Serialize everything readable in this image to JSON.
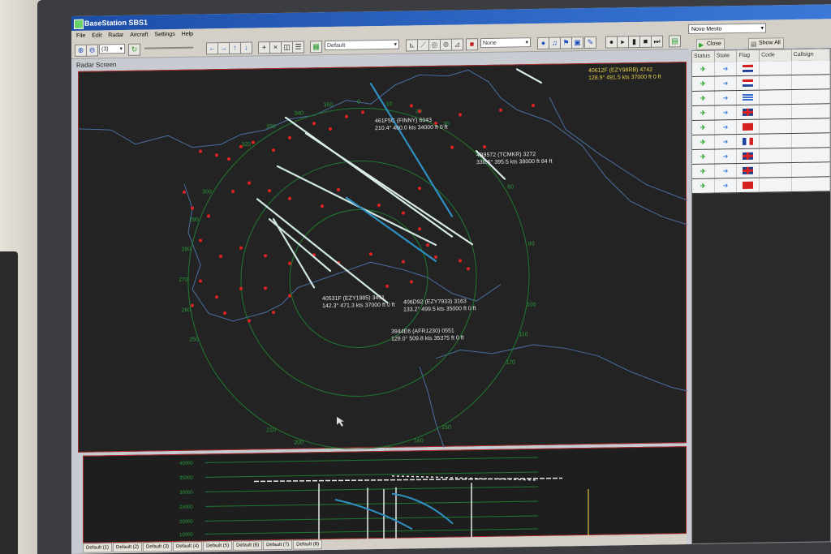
{
  "window": {
    "title": "BaseStation SBS1"
  },
  "menu": [
    "File",
    "Edit",
    "Radar",
    "Aircraft",
    "Settings",
    "Help"
  ],
  "toolbar": {
    "zoom_value": "(3)",
    "profile_select": "Default",
    "filter_select": "None",
    "location_select": "Novo Mesto",
    "close_label": "Close",
    "show_all_label": "Show All"
  },
  "radar": {
    "label": "Radar Screen",
    "bearings": [
      "340",
      "350",
      "0",
      "10",
      "20",
      "30",
      "60",
      "80",
      "100",
      "110",
      "120",
      "150",
      "160",
      "170",
      "180",
      "190",
      "200",
      "210",
      "250",
      "260",
      "270",
      "280",
      "290",
      "300",
      "320",
      "330"
    ],
    "aircraft": [
      {
        "id": "40612F",
        "line1": "40612F (EZY98RB) 4742",
        "line2": "128.9° 491.5 kts 37000 ft 0 ft"
      },
      {
        "id": "461F5C",
        "line1": "461F5C (FINNY) 6043",
        "line2": "210.4° 460.0 kts 34000 ft 0 ft"
      },
      {
        "id": "4B9572",
        "line1": "4B9572 (TCMKR) 3272",
        "line2": "330.5° 395.5 kts 38000 ft 84 ft"
      },
      {
        "id": "40531F",
        "line1": "40531F (EZY1985) 3451",
        "line2": "142.3° 471.3 kts 37000 ft 0 ft"
      },
      {
        "id": "406D92",
        "line1": "406D92 (EZY7933) 3163",
        "line2": "133.2° 499.5 kts 35000 ft 0 ft"
      },
      {
        "id": "3944E6",
        "line1": "3944E6 (AFR1230) 0551",
        "line2": "128.0° 509.8 kts 35375 ft 0 ft"
      }
    ]
  },
  "altitude_panel": {
    "labels": [
      "40000",
      "35000",
      "30000",
      "25000",
      "20000",
      "10000"
    ]
  },
  "tabs": [
    "Default (1)",
    "Default (2)",
    "Default (3)",
    "Default (4)",
    "Default (5)",
    "Default (6)",
    "Default (7)",
    "Default (8)"
  ],
  "list": {
    "columns": [
      "Status",
      "State",
      "Flag",
      "Code",
      "Callsign"
    ],
    "rows": [
      {
        "flag": "hr"
      },
      {
        "flag": "hr"
      },
      {
        "flag": "gr"
      },
      {
        "flag": "gb"
      },
      {
        "flag": "tr"
      },
      {
        "flag": "fr"
      },
      {
        "flag": "gb"
      },
      {
        "flag": "gb"
      },
      {
        "flag": "tr"
      }
    ]
  }
}
